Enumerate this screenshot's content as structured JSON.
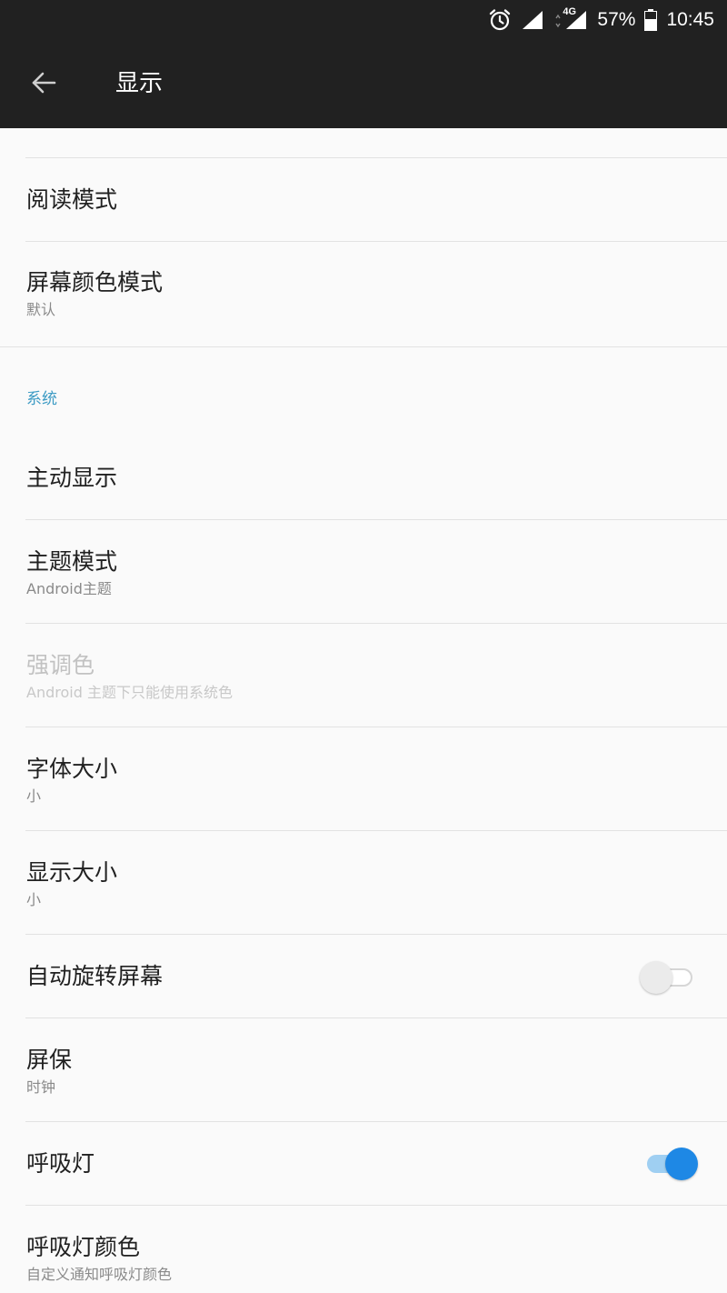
{
  "status_bar": {
    "network": "4G",
    "battery": "57%",
    "time": "10:45"
  },
  "app_bar": {
    "title": "显示"
  },
  "items": {
    "reading_mode": {
      "title": "阅读模式"
    },
    "screen_color_mode": {
      "title": "屏幕颜色模式",
      "subtitle": "默认"
    },
    "section_system": "系统",
    "ambient_display": {
      "title": "主动显示"
    },
    "theme_mode": {
      "title": "主题模式",
      "subtitle": "Android主题"
    },
    "accent_color": {
      "title": "强调色",
      "subtitle": "Android 主题下只能使用系统色"
    },
    "font_size": {
      "title": "字体大小",
      "subtitle": "小"
    },
    "display_size": {
      "title": "显示大小",
      "subtitle": "小"
    },
    "auto_rotate": {
      "title": "自动旋转屏幕",
      "enabled": false
    },
    "screensaver": {
      "title": "屏保",
      "subtitle": "时钟"
    },
    "notification_light": {
      "title": "呼吸灯",
      "enabled": true
    },
    "notification_light_color": {
      "title": "呼吸灯颜色",
      "subtitle": "自定义通知呼吸灯颜色"
    }
  },
  "colors": {
    "app_bar_bg": "#212121",
    "background": "#fafafa",
    "accent": "#1e88e5",
    "section_header": "#3d9bc4"
  }
}
